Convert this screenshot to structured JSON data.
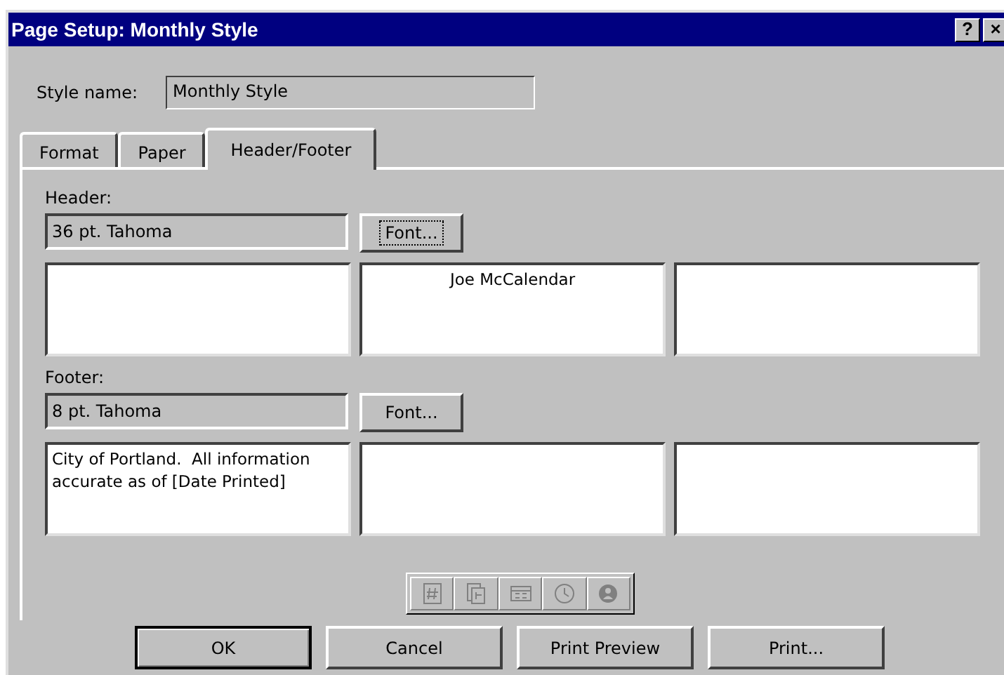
{
  "window": {
    "title": "Page Setup: Monthly Style",
    "controls": [
      "?",
      "×"
    ]
  },
  "style_name": {
    "label": "Style name:",
    "value": "Monthly Style"
  },
  "tabs": [
    {
      "label": "Format",
      "selected": false
    },
    {
      "label": "Paper",
      "selected": false
    },
    {
      "label": "Header/Footer",
      "selected": true
    }
  ],
  "sections": [
    {
      "label": "Header:",
      "font": "36 pt. Tahoma",
      "font_button": {
        "label": "Font...",
        "focused": true
      },
      "center_text": "Joe McCalendar"
    },
    {
      "label": "Footer:",
      "font": "8 pt. Tahoma",
      "font_button": {
        "label": "Font...",
        "focused": false
      },
      "left_text": "City of Portland.  All information accurate as of [Date Printed]"
    }
  ],
  "insert_toolbar": {
    "disabled": true
  },
  "buttons": [
    {
      "label": "OK",
      "default": true
    },
    {
      "label": "Cancel",
      "default": false
    },
    {
      "label": "Print Preview",
      "default": false
    },
    {
      "label": "Print...",
      "default": false
    }
  ]
}
